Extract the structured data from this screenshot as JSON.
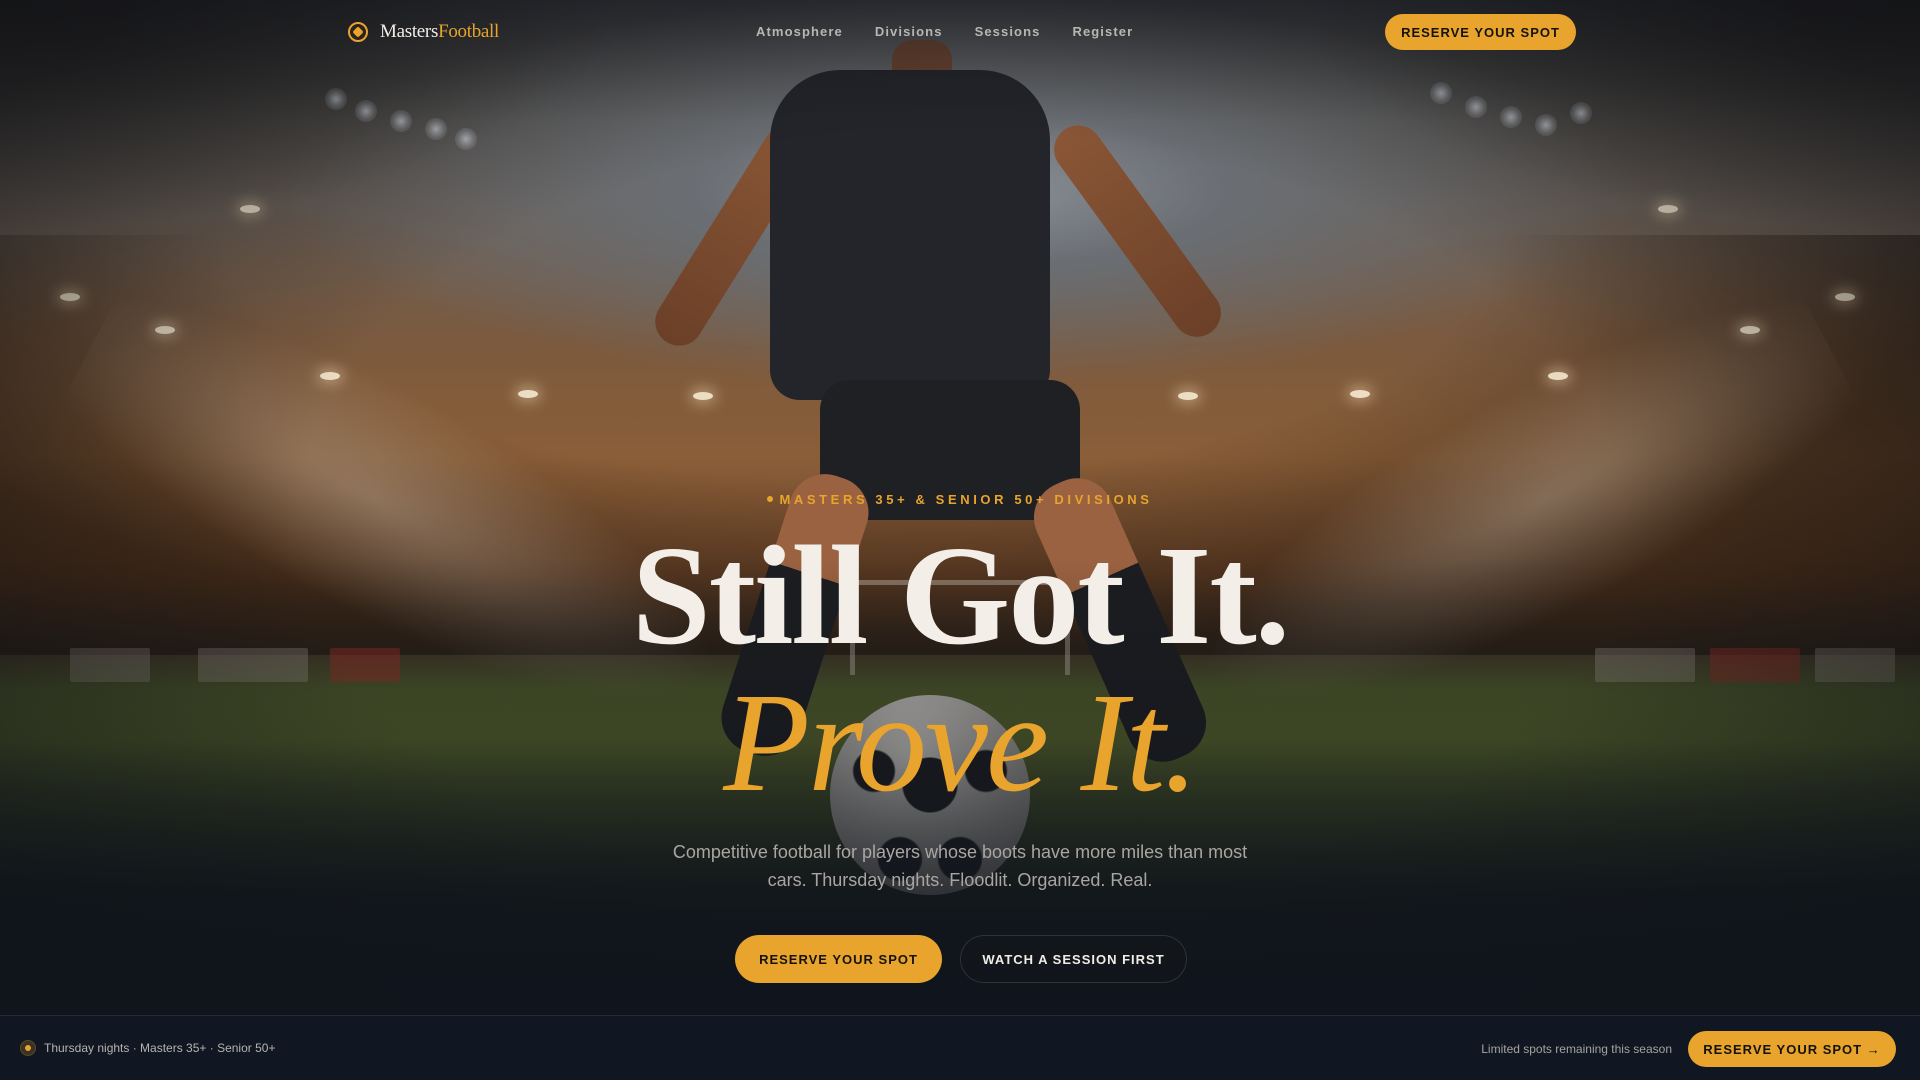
{
  "brand": {
    "name_part1": "Masters",
    "name_part2": "Football",
    "logo_icon": "shield-crest-icon"
  },
  "nav": {
    "links": [
      "Atmosphere",
      "Divisions",
      "Sessions",
      "Register"
    ],
    "cta_label": "RESERVE YOUR SPOT"
  },
  "hero": {
    "eyebrow": "MASTERS 35+ & SENIOR 50+ DIVISIONS",
    "headline_line1": "Still Got It.",
    "headline_line2": "Prove It.",
    "subtext": "Competitive football for players whose boots have more miles than most cars. Thursday nights. Floodlit. Organized. Real.",
    "primary_cta": "RESERVE YOUR SPOT",
    "secondary_cta": "WATCH A SESSION FIRST"
  },
  "bottom_bar": {
    "info": "Thursday nights · Masters 35+ · Senior 50+",
    "note": "Limited spots remaining this season",
    "cta_label": "RESERVE YOUR SPOT →"
  },
  "colors": {
    "accent": "#e8a42c",
    "background": "#111722",
    "headline": "#f3efe8"
  }
}
